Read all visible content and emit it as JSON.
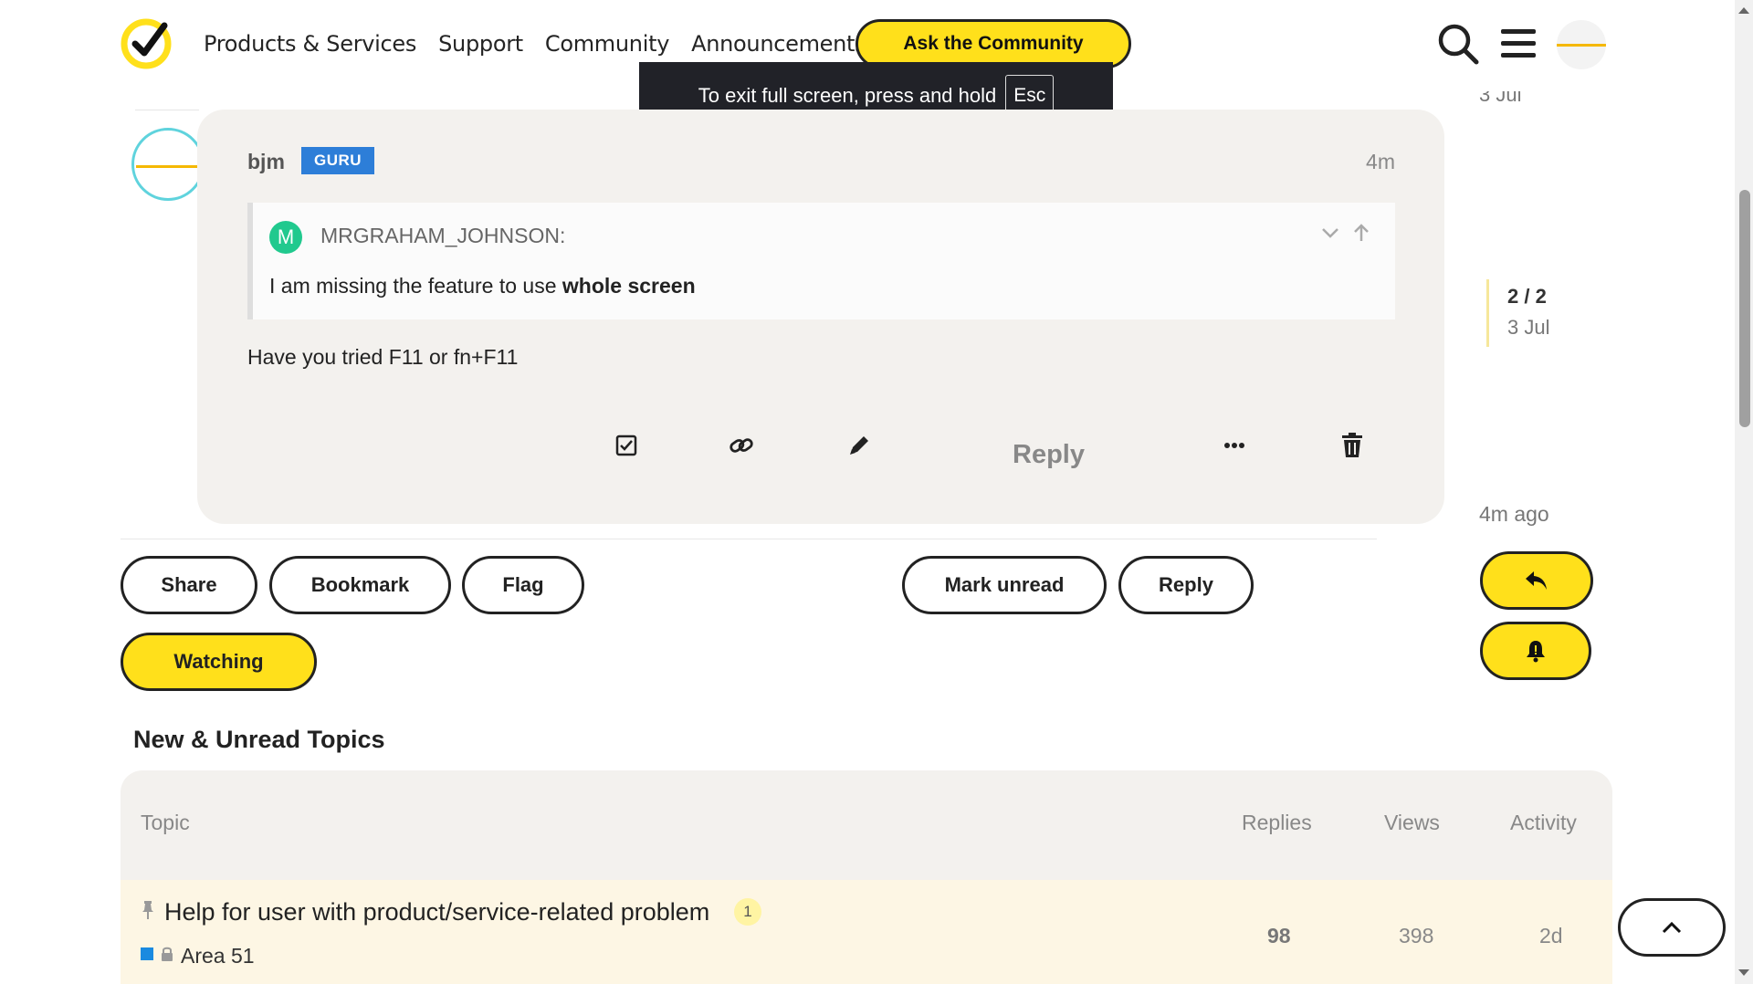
{
  "header": {
    "nav": [
      "Products & Services",
      "Support",
      "Community",
      "Announcements"
    ],
    "ask_button": "Ask the Community"
  },
  "toast": {
    "text": "To exit full screen, press and hold",
    "key": "Esc"
  },
  "post": {
    "username": "bjm",
    "badge": "GURU",
    "time": "4m",
    "quote": {
      "avatar_letter": "M",
      "author": "MRGRAHAM_JOHNSON:",
      "text_prefix": "I am missing the feature to use ",
      "text_bold": "whole screen"
    },
    "body": "Have you tried F11 or fn+F11",
    "reply_label": "Reply"
  },
  "footer_buttons": {
    "share": "Share",
    "bookmark": "Bookmark",
    "flag": "Flag",
    "mark_unread": "Mark unread",
    "reply": "Reply",
    "watching": "Watching"
  },
  "timeline": {
    "top_date": "3 Jul",
    "position": "2 / 2",
    "date": "3 Jul",
    "ago": "4m ago"
  },
  "topics": {
    "section_title": "New & Unread Topics",
    "columns": [
      "Topic",
      "Replies",
      "Views",
      "Activity"
    ],
    "rows": [
      {
        "title": "Help for user with product/service-related problem",
        "unread": "1",
        "category": "Area 51",
        "replies": "98",
        "views": "398",
        "activity": "2d"
      }
    ]
  },
  "colors": {
    "brand_yellow": "#ffe01b",
    "guru_badge": "#2d7ed8",
    "card_bg": "#f3f1ee"
  }
}
